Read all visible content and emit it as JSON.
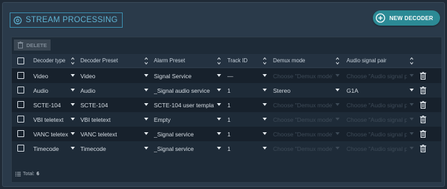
{
  "header": {
    "title": "STREAM PROCESSING",
    "title_icon": "settings-gear-icon",
    "new_decoder_label": "NEW DECODER",
    "new_decoder_icon": "plus-circle-icon"
  },
  "toolbar": {
    "delete_label": "DELETE",
    "delete_icon": "trash-icon"
  },
  "columns": {
    "decoder_type": "Decoder type",
    "decoder_preset": "Decoder Preset",
    "alarm_preset": "Alarm Preset",
    "track_id": "Track ID",
    "demux_mode": "Demux mode",
    "audio_signal_pair": "Audio signal pair"
  },
  "rows": [
    {
      "decoder_type": "Video",
      "decoder_preset": "Video",
      "alarm_preset": "Signal Service",
      "track_id": "—",
      "demux_mode": "Choose \"Demux mode\"",
      "audio_signal_pair": "Choose \"Audio signal pair\""
    },
    {
      "decoder_type": "Audio",
      "decoder_preset": "Audio",
      "alarm_preset": "_Signal audio service",
      "track_id": "1",
      "demux_mode": "Stereo",
      "audio_signal_pair": "G1A"
    },
    {
      "decoder_type": "SCTE-104",
      "decoder_preset": "SCTE-104",
      "alarm_preset": "SCTE-104 user template",
      "track_id": "1",
      "demux_mode": "Choose \"Demux mode\"",
      "audio_signal_pair": "Choose \"Audio signal pair\""
    },
    {
      "decoder_type": "VBI teletext",
      "decoder_preset": "VBI teletext",
      "alarm_preset": "Empty",
      "track_id": "1",
      "demux_mode": "Choose \"Demux mode\"",
      "audio_signal_pair": "Choose \"Audio signal pair\""
    },
    {
      "decoder_type": "VANC teletext",
      "decoder_preset": "VANC teletext",
      "alarm_preset": "_Signal service",
      "track_id": "1",
      "demux_mode": "Choose \"Demux mode\"",
      "audio_signal_pair": "Choose \"Audio signal pair\""
    },
    {
      "decoder_type": "Timecode",
      "decoder_preset": "Timecode",
      "alarm_preset": "_Signal service",
      "track_id": "1",
      "demux_mode": "Choose \"Demux mode\"",
      "audio_signal_pair": "Choose \"Audio signal pair\""
    }
  ],
  "placeholder_flags": [
    {
      "demux": true,
      "audio": true
    },
    {
      "demux": false,
      "audio": false
    },
    {
      "demux": true,
      "audio": true
    },
    {
      "demux": true,
      "audio": true
    },
    {
      "demux": true,
      "audio": true
    },
    {
      "demux": true,
      "audio": true
    }
  ],
  "footer": {
    "total_label": "Total:",
    "total_count": "6",
    "list_icon": "list-icon"
  },
  "colors": {
    "accent": "#5fb3d3",
    "button": "#2c8a95",
    "background": "#2a3a4a"
  }
}
